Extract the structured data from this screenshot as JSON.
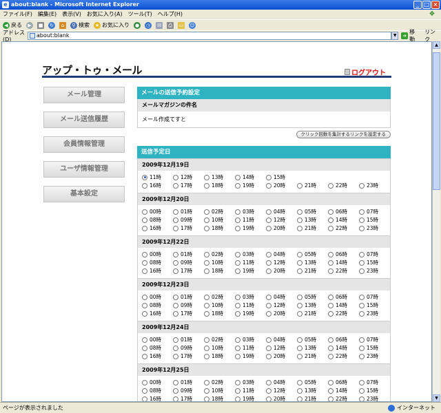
{
  "window": {
    "title": "about:blank - Microsoft Internet Explorer"
  },
  "menu": [
    "ファイル(F)",
    "編集(E)",
    "表示(V)",
    "お気に入り(A)",
    "ツール(T)",
    "ヘルプ(H)"
  ],
  "toolbar": {
    "back": "戻る",
    "search": "検索",
    "favorites": "お気に入り"
  },
  "address": {
    "label": "アドレス(D)",
    "value": "about:blank",
    "go": "移動",
    "links": "リンク"
  },
  "status": {
    "text": "ページが表示されました",
    "zone": "インターネット"
  },
  "page": {
    "logo": "アップ・トゥ・メール",
    "logout": "ログアウト",
    "sidemenu": [
      "メール管理",
      "メール送信履歴",
      "会員情報管理",
      "ユーザ情報管理",
      "基本設定"
    ],
    "section_title": "メールの送信予約設定",
    "subject_label": "メールマガジンの件名",
    "subject_value": "メール作成てすと",
    "link_button": "クリック回数を集計するリンクを設定する",
    "schedule_title": "送信予定日",
    "dates": [
      {
        "date": "2009年12月19日",
        "start": 11,
        "selected": "11時"
      },
      {
        "date": "2009年12月20日",
        "start": 0,
        "selected": null
      },
      {
        "date": "2009年12月22日",
        "start": 0,
        "selected": null
      },
      {
        "date": "2009年12月23日",
        "start": 0,
        "selected": null
      },
      {
        "date": "2009年12月24日",
        "start": 0,
        "selected": null
      },
      {
        "date": "2009年12月25日",
        "start": 0,
        "selected": null
      }
    ]
  }
}
